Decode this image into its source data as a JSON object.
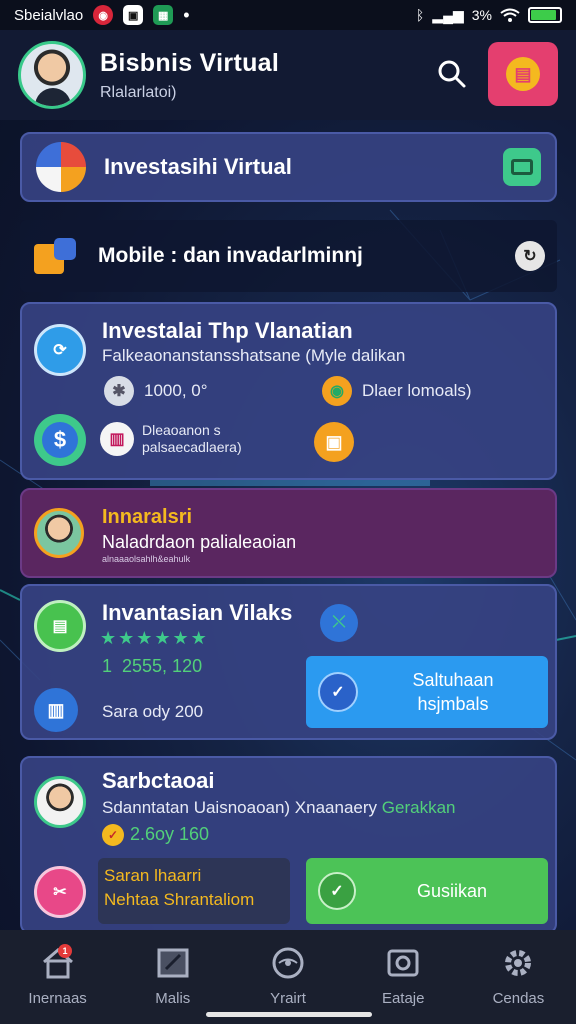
{
  "status_bar": {
    "carrier": "Sbeialvlao",
    "battery_text": "3%",
    "battery_level": 0.9
  },
  "header": {
    "title": "Bisbnis Virtual",
    "subtitle": "Rlalarlatoi)"
  },
  "card_investasi": {
    "title": "Investasihi Virtual"
  },
  "mobile_row": {
    "text": "Mobile : dan  invadarlminnj"
  },
  "card_main": {
    "title": "Investalai Thp Vlanatian",
    "subtitle": "Falkeaonanstansshatsane (Myle dalikan",
    "stat_amount": "1000, 0°",
    "stat_right": "Dlaer lomoals)",
    "desc_line1": "Dleaoanon s",
    "desc_line2": "palsaecadlaera)",
    "colors": {
      "accent_green": "#3ec98b",
      "accent_orange": "#f4a11f"
    }
  },
  "card_promo": {
    "title": "Innaralsri",
    "subtitle": "Naladrdaon palialeaoian",
    "small": "alnaaaolsahlh&eahulk"
  },
  "card_rating": {
    "title": "Invantasian Vilaks",
    "stars": "★★★★★★",
    "rating_num": "1  2555, 120",
    "footer": "Sara ody 200",
    "button_line1": "Saltuhaan",
    "button_line2": "hsjmbals"
  },
  "card_bottom": {
    "title": "Sarbctaoai",
    "subtitle_main": "Sdanntatan Uaisnoaoan) Xnaanaery",
    "subtitle_accent": "Gerakkan",
    "price": "2.6oy 160",
    "box_line1": "Saran lhaarri",
    "box_line2": "Nehtaa Shrantaliom",
    "button": "Gusiikan"
  },
  "bottom_nav": {
    "items": [
      {
        "label": "Inernaas",
        "icon": "home-icon"
      },
      {
        "label": "Malis",
        "icon": "mail-icon"
      },
      {
        "label": "Yrairt",
        "icon": "eye-icon"
      },
      {
        "label": "Eataje",
        "icon": "camera-icon"
      },
      {
        "label": "Cendas",
        "icon": "settings-icon"
      }
    ],
    "badge": "1"
  }
}
